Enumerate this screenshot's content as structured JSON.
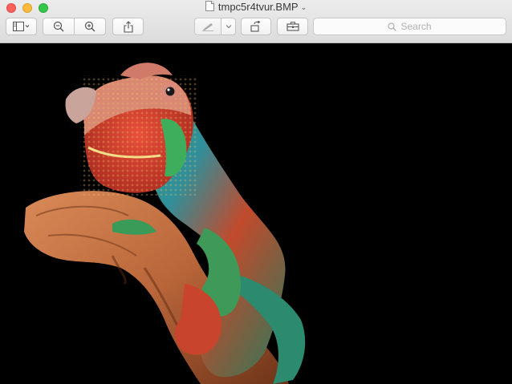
{
  "window": {
    "title": "tmpc5r4tvur.BMP",
    "title_chevron": "⌄"
  },
  "toolbar": {
    "sidebar_button_icon": "sidebar-icon",
    "zoom_out_icon": "zoom-out-icon",
    "zoom_in_icon": "zoom-in-icon",
    "share_icon": "share-icon",
    "markup_icon": "pen-icon",
    "rotate_icon": "rotate-icon",
    "toolbox_icon": "toolbox-icon"
  },
  "search": {
    "placeholder": "Search"
  },
  "image": {
    "subject": "chameleon",
    "background": "#000000"
  }
}
